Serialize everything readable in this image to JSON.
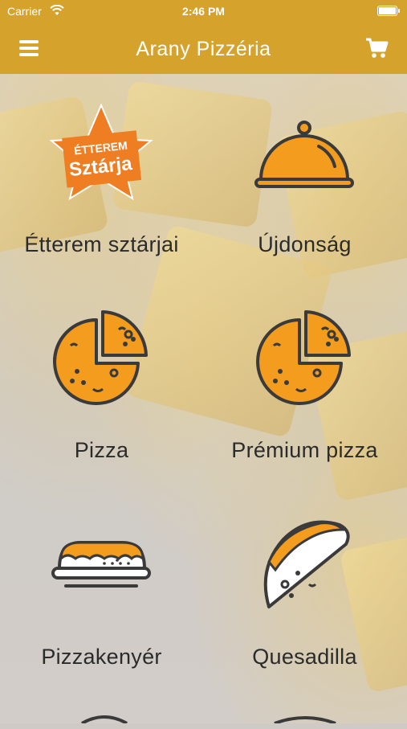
{
  "status_bar": {
    "carrier": "Carrier",
    "time": "2:46 PM"
  },
  "header": {
    "title": "Arany Pizzéria",
    "menu_icon": "hamburger-menu-icon",
    "cart_icon": "shopping-cart-icon"
  },
  "colors": {
    "header": "#d5a32c",
    "accent_orange": "#f39c1e",
    "badge_orange": "#ef7d22",
    "icon_outline": "#3a3a3a"
  },
  "categories": [
    {
      "label": "Étterem sztárjai",
      "icon": "etterem-sztarja-badge-icon",
      "badge_line1": "ÉTTEREM",
      "badge_line2": "Sztárja"
    },
    {
      "label": "Újdonság",
      "icon": "serving-cloche-icon"
    },
    {
      "label": "Pizza",
      "icon": "pizza-icon"
    },
    {
      "label": "Prémium pizza",
      "icon": "premium-pizza-icon"
    },
    {
      "label": "Pizzakenyér",
      "icon": "pizza-bread-icon"
    },
    {
      "label": "Quesadilla",
      "icon": "quesadilla-icon"
    }
  ]
}
